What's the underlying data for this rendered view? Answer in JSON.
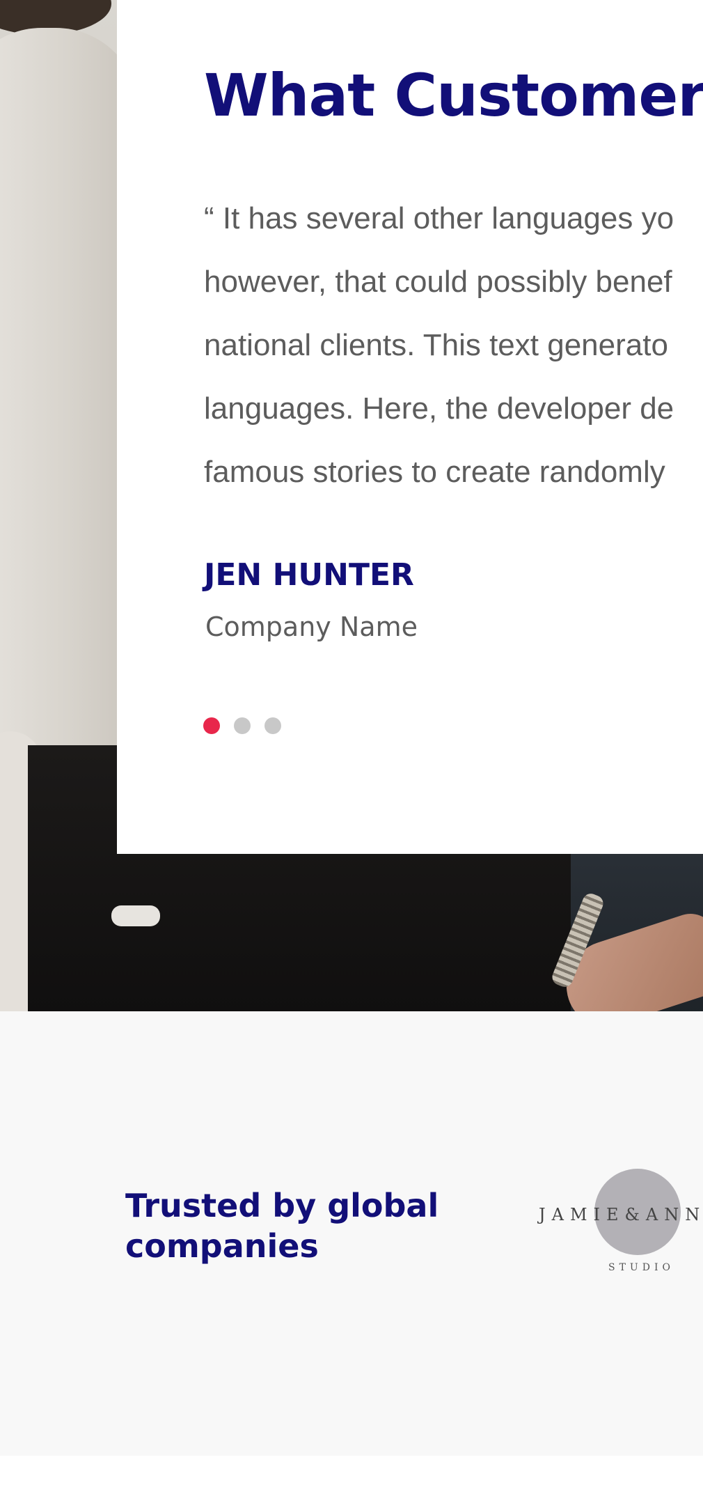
{
  "testimonial": {
    "title": "What Customer",
    "quote_lines": [
      "“ It has several other languages yo",
      "however, that could possibly benef",
      "national clients. This text generato",
      "languages. Here, the developer de",
      "famous stories to create randomly"
    ],
    "author_name": "JEN HUNTER",
    "author_company": "Company Name",
    "slider": {
      "total": 3,
      "active_index": 0,
      "active_color": "#e8274b",
      "inactive_color": "#c8c8c8"
    }
  },
  "trusted": {
    "title_lines": [
      "Trusted by global",
      "companies"
    ],
    "logos": [
      {
        "text": "JAMIE&ANN",
        "subtext": "STUDIO",
        "icon": "circle-logo"
      }
    ]
  },
  "colors": {
    "heading": "#120f78",
    "body_text": "#5c5c5c",
    "section_bg": "#f8f8f8"
  }
}
